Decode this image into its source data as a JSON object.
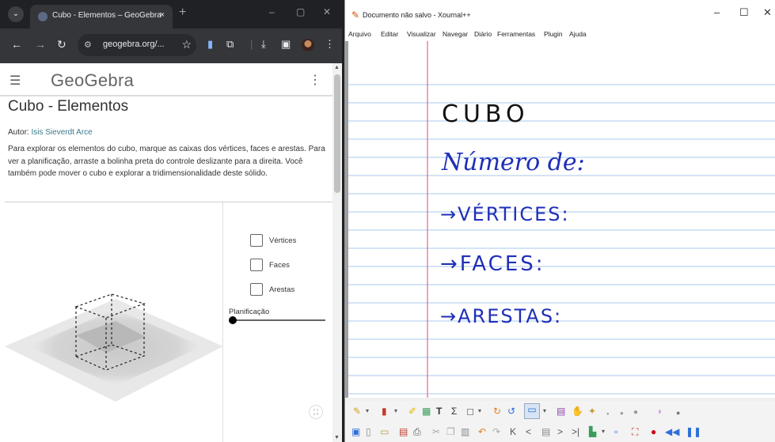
{
  "chrome": {
    "tab_title": "Cubo - Elementos – GeoGebra",
    "tab_close": "×",
    "new_tab": "+",
    "url": "geogebra.org/...",
    "min": "–",
    "max": "▢",
    "close": "✕"
  },
  "geogebra": {
    "logo": "GeoGebra",
    "title": "Cubo - Elementos",
    "author_label": "Autor: ",
    "author_name": "Isis Sieverdt Arce",
    "description": "Para explorar os elementos do cubo, marque as caixas dos vértices, faces e arestas. Para ver a planificação, arraste a bolinha preta do controle deslizante para a direita. Você também pode mover o cubo e explorar a tridimensionalidade deste sólido.",
    "checkboxes": [
      {
        "label": "Vértices",
        "checked": false
      },
      {
        "label": "Faces",
        "checked": false
      },
      {
        "label": "Arestas",
        "checked": false
      }
    ],
    "slider_label": "Planificação",
    "slider_value": 0
  },
  "xournal": {
    "window_title": "Documento não salvo - Xournal++",
    "min": "–",
    "max": "☐",
    "close": "✕",
    "menu": [
      "Arquivo",
      "Editar",
      "Visualizar",
      "Navegar",
      "Diário",
      "Ferramentas",
      "Plugin",
      "Ajuda"
    ],
    "notes": {
      "line1": "CUBO",
      "line2": "Número de:",
      "line3": "→VÉRTICES:",
      "line4": "→FACES:",
      "line5": "→ARESTAS:"
    },
    "colors": {
      "ink_black": "#111111",
      "ink_blue": "#1f2fb8",
      "rule_blue": "#a9c8ee",
      "margin_red": "#e06a8a"
    }
  }
}
